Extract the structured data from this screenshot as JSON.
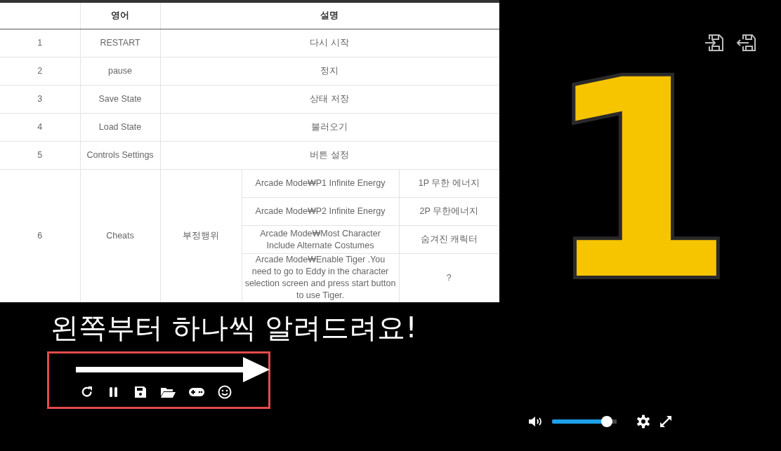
{
  "table": {
    "columns": [
      "영어",
      "설명"
    ],
    "rows": [
      {
        "number": "1",
        "english": "RESTART",
        "description": "다시 시작"
      },
      {
        "number": "2",
        "english": "pause",
        "description": "정지"
      },
      {
        "number": "3",
        "english": "Save State",
        "description": "상태 저장"
      },
      {
        "number": "4",
        "english": "Load State",
        "description": "불러오기"
      },
      {
        "number": "5",
        "english": "Controls Settings",
        "description": "버튼 설정"
      },
      {
        "number": "6",
        "english": "Cheats",
        "description": "부정행위",
        "cheats": [
          {
            "name": "Arcade Mode₩P1 Infinite Energy",
            "meaning": "1P 무한 에너지"
          },
          {
            "name": "Arcade Mode₩P2 Infinite Energy",
            "meaning": "2P 무한에너지"
          },
          {
            "name": "Arcade Mode₩Most Character Include Alternate Costumes",
            "meaning": "숨겨진 캐릭터"
          },
          {
            "name": "Arcade Mode₩Enable Tiger .You need to go to Eddy in the character selection screen and press start button to use Tiger.",
            "meaning": "?"
          }
        ]
      }
    ]
  },
  "caption": "왼쪽부터 하나씩 알려드려요!",
  "player": {
    "countdown": "1",
    "volume": {
      "level": 0.85
    }
  }
}
